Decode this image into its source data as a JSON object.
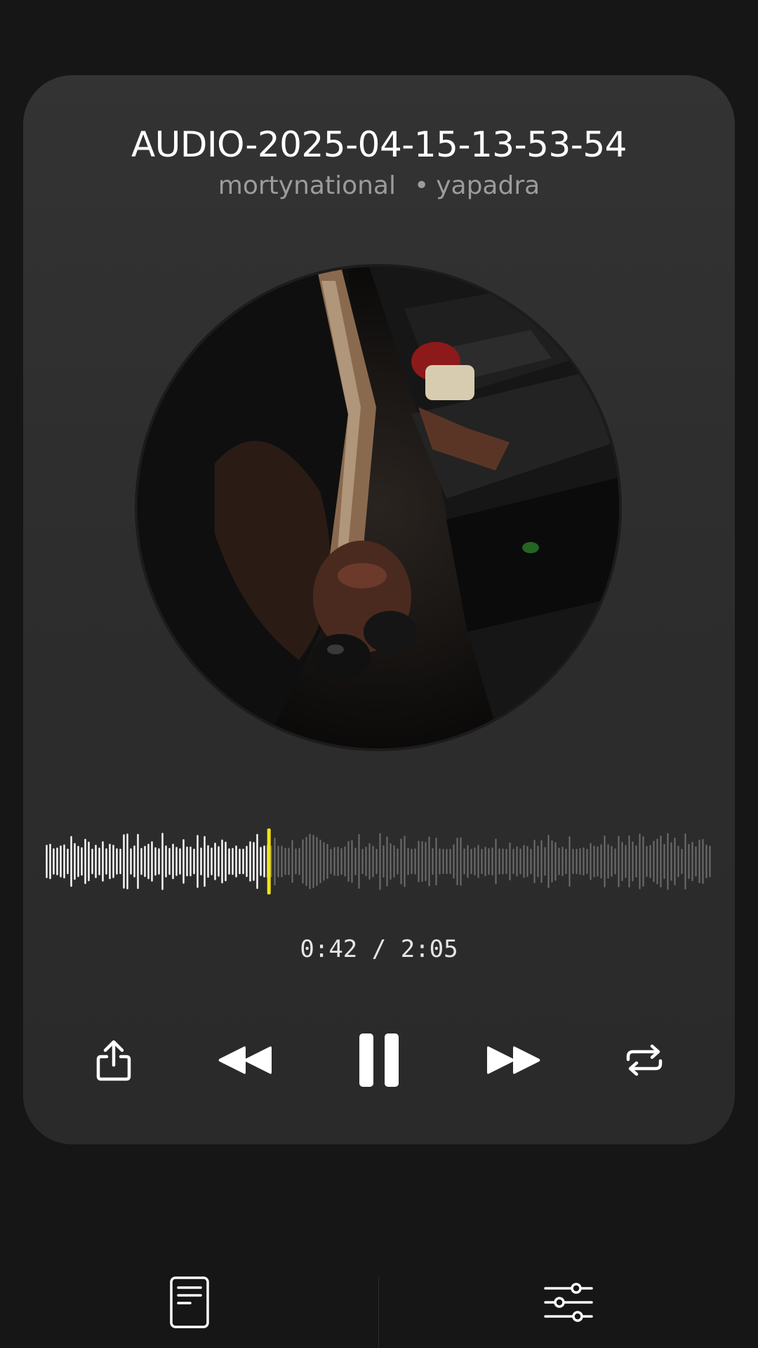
{
  "track": {
    "title": "AUDIO-2025-04-15-13-53-54",
    "artist": "mortynational",
    "separator": "•",
    "album": "yapadra"
  },
  "artwork": {
    "description_icon": "album-artwork"
  },
  "playback": {
    "current_time": "0:42",
    "divider": "/",
    "total_time": "2:05",
    "progress": 0.336,
    "is_playing": true
  },
  "colors": {
    "background": "#161616",
    "card": "#303030",
    "playhead": "#f2e318",
    "played_bar": "#ffffff",
    "unplayed_bar": "#6e6e6e",
    "secondary_text": "#9c9c9c"
  },
  "controls": {
    "share_icon": "share-icon",
    "rewind_icon": "rewind-icon",
    "pause_icon": "pause-icon",
    "forward_icon": "fast-forward-icon",
    "repeat_icon": "repeat-icon"
  },
  "bottom_bar": {
    "left_icon": "lyrics-document-icon",
    "right_icon": "equalizer-sliders-icon"
  }
}
